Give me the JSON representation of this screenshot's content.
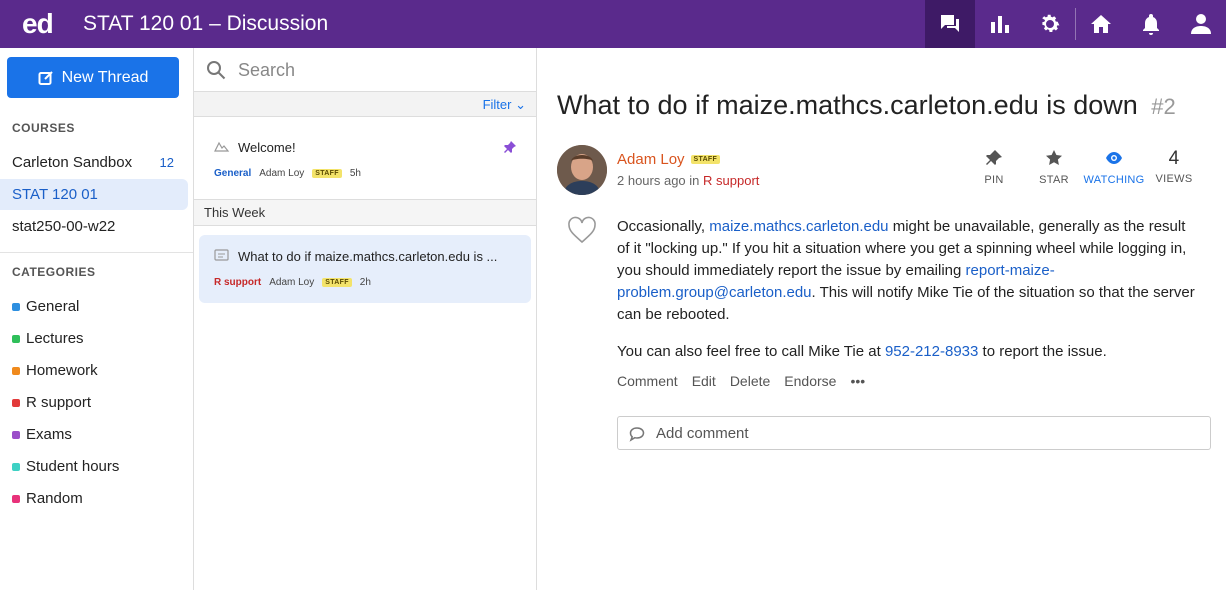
{
  "topbar": {
    "logo": "ed",
    "title": "STAT 120 01 – Discussion",
    "icons": [
      "chat-icon",
      "chart-icon",
      "gear-icon",
      "home-icon",
      "bell-icon",
      "user-icon"
    ]
  },
  "sidebar": {
    "new_thread_label": "New Thread",
    "courses_heading": "COURSES",
    "courses": [
      {
        "label": "Carleton Sandbox",
        "count": "12"
      },
      {
        "label": "STAT 120 01",
        "count": ""
      },
      {
        "label": "stat250-00-w22",
        "count": ""
      }
    ],
    "categories_heading": "CATEGORIES",
    "categories": [
      {
        "label": "General",
        "color": "#2d8fe0"
      },
      {
        "label": "Lectures",
        "color": "#2fbf5a"
      },
      {
        "label": "Homework",
        "color": "#f08a1c"
      },
      {
        "label": "R support",
        "color": "#e23a3a"
      },
      {
        "label": "Exams",
        "color": "#9b4fc9"
      },
      {
        "label": "Student hours",
        "color": "#3ed1c4"
      },
      {
        "label": "Random",
        "color": "#e8327a"
      }
    ]
  },
  "threadlist": {
    "search_placeholder": "Search",
    "filter_label": "Filter",
    "pinned": {
      "title": "Welcome!",
      "category": "General",
      "category_color": "#1a5fc8",
      "author": "Adam Loy",
      "badge": "STAFF",
      "time": "5h"
    },
    "week_heading": "This Week",
    "threads": [
      {
        "title": "What to do if maize.mathcs.carleton.edu is ...",
        "category": "R support",
        "category_color": "#c62828",
        "author": "Adam Loy",
        "badge": "STAFF",
        "time": "2h"
      }
    ]
  },
  "post": {
    "title": "What to do if maize.mathcs.carleton.edu is down",
    "number": "#2",
    "author": "Adam Loy",
    "badge": "STAFF",
    "posted_time": "2 hours ago in",
    "posted_category": "R support",
    "actions": {
      "pin": "PIN",
      "star": "STAR",
      "watching": "WATCHING",
      "views_count": "4",
      "views": "VIEWS"
    },
    "para1": {
      "t1": "Occasionally, ",
      "link1": "maize.mathcs.carleton.edu",
      "t2": " might be unavailable, generally as the result of it \"locking up.\" If you hit a situation where you get a spinning wheel while logging in, you should immediately report the issue by emailing ",
      "link2": "report-maize-problem.group@carleton.edu",
      "t3": ". This will notify Mike Tie of the situation so that the server can be rebooted."
    },
    "para2": {
      "t1": "You can also feel free to call Mike Tie at ",
      "link1": "952-212-8933",
      "t2": " to report the issue."
    },
    "post_actions": [
      "Comment",
      "Edit",
      "Delete",
      "Endorse",
      "•••"
    ],
    "add_comment_placeholder": "Add comment"
  }
}
